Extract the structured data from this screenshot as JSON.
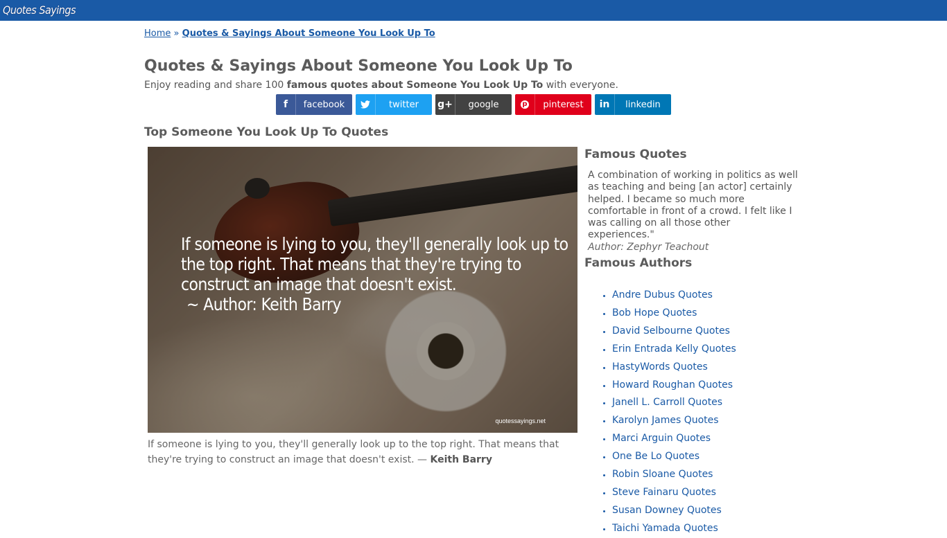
{
  "site": {
    "logo_text": "Quotes Sayings"
  },
  "breadcrumb": {
    "home": "Home",
    "separator": "»",
    "current": "Quotes & Sayings About Someone You Look Up To"
  },
  "page": {
    "title": "Quotes & Sayings About Someone You Look Up To",
    "intro_pre": "Enjoy reading and share 100 ",
    "intro_bold": "famous quotes about Someone You Look Up To",
    "intro_post": " with everyone."
  },
  "share": {
    "facebook": {
      "icon": "f",
      "label": "facebook"
    },
    "twitter": {
      "icon": "t",
      "label": "twitter"
    },
    "google": {
      "icon": "g+",
      "label": "google"
    },
    "pinterest": {
      "icon": "p",
      "label": "pinterest"
    },
    "linkedin": {
      "icon": "in",
      "label": "linkedin"
    }
  },
  "main": {
    "section_title": "Top Someone You Look Up To Quotes",
    "quote_image": {
      "text": "If someone is lying to you, they'll generally look up to the top right. That means that they're trying to construct an image that doesn't exist.",
      "author_line": "~ Author: Keith Barry",
      "watermark": "quotessayings.net"
    },
    "caption": {
      "text": "If someone is lying to you, they'll generally look up to the top right. That means that they're trying to construct an image that doesn't exist. — ",
      "author": "Keith Barry"
    }
  },
  "sidebar": {
    "famous_quotes_title": "Famous Quotes",
    "famous_quote_text": "A combination of working in politics as well as teaching and being [an actor] certainly helped. I became so much more comfortable in front of a crowd. I felt like I was calling on all those other experiences.\"",
    "famous_quote_author": "Author: Zephyr Teachout",
    "famous_authors_title": "Famous Authors",
    "authors": [
      "Andre Dubus Quotes",
      "Bob Hope Quotes",
      "David Selbourne Quotes",
      "Erin Entrada Kelly Quotes",
      "HastyWords Quotes",
      "Howard Roughan Quotes",
      "Janell L. Carroll Quotes",
      "Karolyn James Quotes",
      "Marci Arguin Quotes",
      "One Be Lo Quotes",
      "Robin Sloane Quotes",
      "Steve Fainaru Quotes",
      "Susan Downey Quotes",
      "Taichi Yamada Quotes"
    ]
  },
  "colors": {
    "topbar": "#1a5aa6",
    "link": "#1a5aa6",
    "facebook": "#3b5998",
    "twitter": "#1da1f2",
    "google": "#424242",
    "pinterest": "#e0001b",
    "linkedin": "#0077b5"
  }
}
